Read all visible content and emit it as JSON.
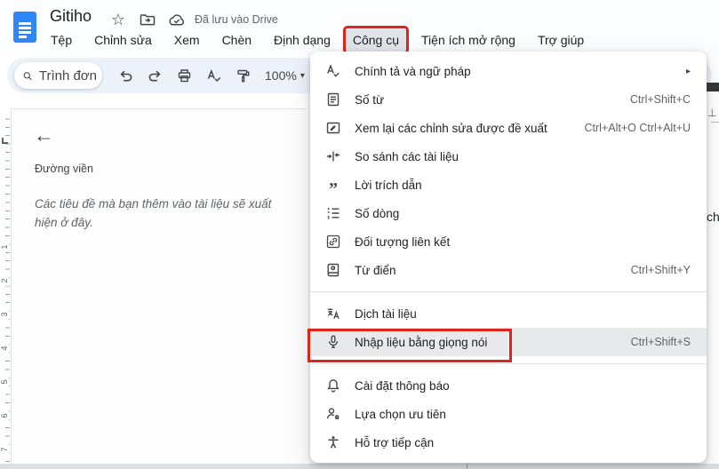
{
  "header": {
    "title": "Gitiho",
    "saved_status": "Đã lưu vào Drive",
    "icons": [
      "docs-logo",
      "star-icon",
      "move-folder-icon",
      "cloud-saved-icon"
    ],
    "menubar": [
      "Tệp",
      "Chỉnh sửa",
      "Xem",
      "Chèn",
      "Định dạng",
      "Công cụ",
      "Tiện ích mở rộng",
      "Trợ giúp"
    ],
    "active_menu": "Công cụ"
  },
  "toolbar": {
    "search_label": "Trình đơn",
    "zoom_level": "100%",
    "icons": [
      "search-icon",
      "undo-icon",
      "redo-icon",
      "print-icon",
      "spellcheck-icon",
      "paint-format-icon",
      "zoom-dropdown-caret"
    ]
  },
  "outline_panel": {
    "title": "Đường viền",
    "empty_hint": "Các tiêu đề mà bạn thêm vào tài liệu sẽ xuất hiện ở đây."
  },
  "ruler": {
    "numbers": [
      "1",
      "2",
      "3",
      "4",
      "5",
      "6",
      "7"
    ]
  },
  "tools_menu": {
    "items": [
      {
        "label": "Chính tả và ngữ pháp",
        "icon": "spellcheck-icon",
        "has_submenu": true
      },
      {
        "label": "Số từ",
        "icon": "word-count-icon",
        "shortcut": "Ctrl+Shift+C"
      },
      {
        "label": "Xem lại các chỉnh sửa được đề xuất",
        "icon": "review-edits-icon",
        "shortcut": "Ctrl+Alt+O Ctrl+Alt+U"
      },
      {
        "label": "So sánh các tài liệu",
        "icon": "compare-documents-icon"
      },
      {
        "label": "Lời trích dẫn",
        "icon": "citations-icon"
      },
      {
        "label": "Số dòng",
        "icon": "line-numbers-icon"
      },
      {
        "label": "Đối tượng liên kết",
        "icon": "linked-objects-icon"
      },
      {
        "label": "Từ điển",
        "icon": "dictionary-icon",
        "shortcut": "Ctrl+Shift+Y"
      },
      {
        "label": "Dịch tài liệu",
        "icon": "translate-icon"
      },
      {
        "label": "Nhập liệu bằng giọng nói",
        "icon": "microphone-icon",
        "shortcut": "Ctrl+Shift+S",
        "highlighted": true
      },
      {
        "label": "Cài đặt thông báo",
        "icon": "notification-bell-icon"
      },
      {
        "label": "Lựa chọn ưu tiên",
        "icon": "preferences-icon"
      },
      {
        "label": "Hỗ trợ tiếp cận",
        "icon": "accessibility-icon"
      }
    ],
    "submenu_arrow": "▸"
  },
  "annotations": {
    "highlight_color": "#df241b",
    "highlighted_items": [
      "Công cụ",
      "Nhập liệu bằng giọng nói"
    ]
  },
  "document_edge": {
    "partial_text": "ch",
    "indent_marker": "⊥"
  }
}
